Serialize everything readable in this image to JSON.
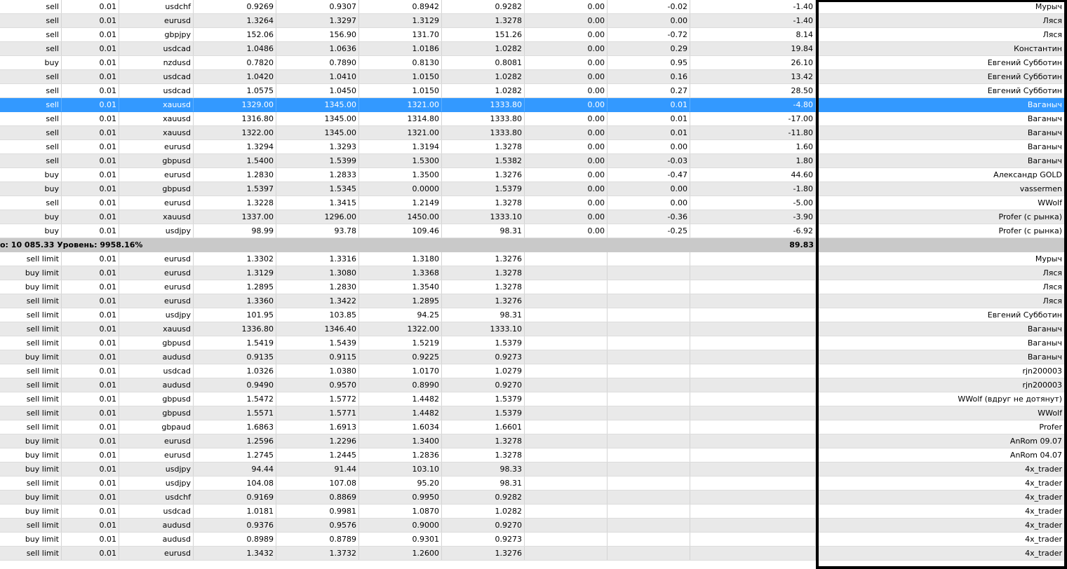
{
  "positions": [
    {
      "type": "sell",
      "volume": "0.01",
      "symbol": "usdchf",
      "price": "0.9269",
      "sl": "0.9307",
      "tp": "0.8942",
      "current": "0.9282",
      "commission": "0.00",
      "swap": "-0.02",
      "profit": "-1.40",
      "comment": "Мурыч"
    },
    {
      "type": "sell",
      "volume": "0.01",
      "symbol": "eurusd",
      "price": "1.3264",
      "sl": "1.3297",
      "tp": "1.3129",
      "current": "1.3278",
      "commission": "0.00",
      "swap": "0.00",
      "profit": "-1.40",
      "comment": "Ляся"
    },
    {
      "type": "sell",
      "volume": "0.01",
      "symbol": "gbpjpy",
      "price": "152.06",
      "sl": "156.90",
      "tp": "131.70",
      "current": "151.26",
      "commission": "0.00",
      "swap": "-0.72",
      "profit": "8.14",
      "comment": "Ляся"
    },
    {
      "type": "sell",
      "volume": "0.01",
      "symbol": "usdcad",
      "price": "1.0486",
      "sl": "1.0636",
      "tp": "1.0186",
      "current": "1.0282",
      "commission": "0.00",
      "swap": "0.29",
      "profit": "19.84",
      "comment": "Константин"
    },
    {
      "type": "buy",
      "volume": "0.01",
      "symbol": "nzdusd",
      "price": "0.7820",
      "sl": "0.7890",
      "tp": "0.8130",
      "current": "0.8081",
      "commission": "0.00",
      "swap": "0.95",
      "profit": "26.10",
      "comment": "Евгений Субботин"
    },
    {
      "type": "sell",
      "volume": "0.01",
      "symbol": "usdcad",
      "price": "1.0420",
      "sl": "1.0410",
      "tp": "1.0150",
      "current": "1.0282",
      "commission": "0.00",
      "swap": "0.16",
      "profit": "13.42",
      "comment": "Евгений Субботин"
    },
    {
      "type": "sell",
      "volume": "0.01",
      "symbol": "usdcad",
      "price": "1.0575",
      "sl": "1.0450",
      "tp": "1.0150",
      "current": "1.0282",
      "commission": "0.00",
      "swap": "0.27",
      "profit": "28.50",
      "comment": "Евгений Субботин"
    },
    {
      "type": "sell",
      "volume": "0.01",
      "symbol": "xauusd",
      "price": "1329.00",
      "sl": "1345.00",
      "tp": "1321.00",
      "current": "1333.80",
      "commission": "0.00",
      "swap": "0.01",
      "profit": "-4.80",
      "comment": "Ваганыч",
      "selected": true
    },
    {
      "type": "sell",
      "volume": "0.01",
      "symbol": "xauusd",
      "price": "1316.80",
      "sl": "1345.00",
      "tp": "1314.80",
      "current": "1333.80",
      "commission": "0.00",
      "swap": "0.01",
      "profit": "-17.00",
      "comment": "Ваганыч"
    },
    {
      "type": "sell",
      "volume": "0.01",
      "symbol": "xauusd",
      "price": "1322.00",
      "sl": "1345.00",
      "tp": "1321.00",
      "current": "1333.80",
      "commission": "0.00",
      "swap": "0.01",
      "profit": "-11.80",
      "comment": "Ваганыч"
    },
    {
      "type": "sell",
      "volume": "0.01",
      "symbol": "eurusd",
      "price": "1.3294",
      "sl": "1.3293",
      "tp": "1.3194",
      "current": "1.3278",
      "commission": "0.00",
      "swap": "0.00",
      "profit": "1.60",
      "comment": "Ваганыч"
    },
    {
      "type": "sell",
      "volume": "0.01",
      "symbol": "gbpusd",
      "price": "1.5400",
      "sl": "1.5399",
      "tp": "1.5300",
      "current": "1.5382",
      "commission": "0.00",
      "swap": "-0.03",
      "profit": "1.80",
      "comment": "Ваганыч"
    },
    {
      "type": "buy",
      "volume": "0.01",
      "symbol": "eurusd",
      "price": "1.2830",
      "sl": "1.2833",
      "tp": "1.3500",
      "current": "1.3276",
      "commission": "0.00",
      "swap": "-0.47",
      "profit": "44.60",
      "comment": "Александр GOLD"
    },
    {
      "type": "buy",
      "volume": "0.01",
      "symbol": "gbpusd",
      "price": "1.5397",
      "sl": "1.5345",
      "tp": "0.0000",
      "current": "1.5379",
      "commission": "0.00",
      "swap": "0.00",
      "profit": "-1.80",
      "comment": "vassermen"
    },
    {
      "type": "sell",
      "volume": "0.01",
      "symbol": "eurusd",
      "price": "1.3228",
      "sl": "1.3415",
      "tp": "1.2149",
      "current": "1.3278",
      "commission": "0.00",
      "swap": "0.00",
      "profit": "-5.00",
      "comment": "WWolf"
    },
    {
      "type": "buy",
      "volume": "0.01",
      "symbol": "xauusd",
      "price": "1337.00",
      "sl": "1296.00",
      "tp": "1450.00",
      "current": "1333.10",
      "commission": "0.00",
      "swap": "-0.36",
      "profit": "-3.90",
      "comment": "Profer (с рынка)"
    },
    {
      "type": "buy",
      "volume": "0.01",
      "symbol": "usdjpy",
      "price": "98.99",
      "sl": "93.78",
      "tp": "109.46",
      "current": "98.31",
      "commission": "0.00",
      "swap": "-0.25",
      "profit": "-6.92",
      "comment": "Profer (с рынка)"
    }
  ],
  "summary": {
    "text": "o: 10 085.33  Уровень: 9958.16%",
    "profit": "89.83"
  },
  "orders": [
    {
      "type": "sell limit",
      "volume": "0.01",
      "symbol": "eurusd",
      "price": "1.3302",
      "sl": "1.3316",
      "tp": "1.3180",
      "current": "1.3276",
      "comment": "Мурыч"
    },
    {
      "type": "buy limit",
      "volume": "0.01",
      "symbol": "eurusd",
      "price": "1.3129",
      "sl": "1.3080",
      "tp": "1.3368",
      "current": "1.3278",
      "comment": "Ляся"
    },
    {
      "type": "buy limit",
      "volume": "0.01",
      "symbol": "eurusd",
      "price": "1.2895",
      "sl": "1.2830",
      "tp": "1.3540",
      "current": "1.3278",
      "comment": "Ляся"
    },
    {
      "type": "sell limit",
      "volume": "0.01",
      "symbol": "eurusd",
      "price": "1.3360",
      "sl": "1.3422",
      "tp": "1.2895",
      "current": "1.3276",
      "comment": "Ляся"
    },
    {
      "type": "sell limit",
      "volume": "0.01",
      "symbol": "usdjpy",
      "price": "101.95",
      "sl": "103.85",
      "tp": "94.25",
      "current": "98.31",
      "comment": "Евгений Субботин"
    },
    {
      "type": "sell limit",
      "volume": "0.01",
      "symbol": "xauusd",
      "price": "1336.80",
      "sl": "1346.40",
      "tp": "1322.00",
      "current": "1333.10",
      "comment": "Ваганыч"
    },
    {
      "type": "sell limit",
      "volume": "0.01",
      "symbol": "gbpusd",
      "price": "1.5419",
      "sl": "1.5439",
      "tp": "1.5219",
      "current": "1.5379",
      "comment": "Ваганыч"
    },
    {
      "type": "buy limit",
      "volume": "0.01",
      "symbol": "audusd",
      "price": "0.9135",
      "sl": "0.9115",
      "tp": "0.9225",
      "current": "0.9273",
      "comment": "Ваганыч"
    },
    {
      "type": "sell limit",
      "volume": "0.01",
      "symbol": "usdcad",
      "price": "1.0326",
      "sl": "1.0380",
      "tp": "1.0170",
      "current": "1.0279",
      "comment": "rjn200003"
    },
    {
      "type": "sell limit",
      "volume": "0.01",
      "symbol": "audusd",
      "price": "0.9490",
      "sl": "0.9570",
      "tp": "0.8990",
      "current": "0.9270",
      "comment": "rjn200003"
    },
    {
      "type": "sell limit",
      "volume": "0.01",
      "symbol": "gbpusd",
      "price": "1.5472",
      "sl": "1.5772",
      "tp": "1.4482",
      "current": "1.5379",
      "comment": "WWolf (вдруг не дотянут)"
    },
    {
      "type": "sell limit",
      "volume": "0.01",
      "symbol": "gbpusd",
      "price": "1.5571",
      "sl": "1.5771",
      "tp": "1.4482",
      "current": "1.5379",
      "comment": "WWolf"
    },
    {
      "type": "sell limit",
      "volume": "0.01",
      "symbol": "gbpaud",
      "price": "1.6863",
      "sl": "1.6913",
      "tp": "1.6034",
      "current": "1.6601",
      "comment": "Profer"
    },
    {
      "type": "buy limit",
      "volume": "0.01",
      "symbol": "eurusd",
      "price": "1.2596",
      "sl": "1.2296",
      "tp": "1.3400",
      "current": "1.3278",
      "comment": "AnRom 09.07"
    },
    {
      "type": "buy limit",
      "volume": "0.01",
      "symbol": "eurusd",
      "price": "1.2745",
      "sl": "1.2445",
      "tp": "1.2836",
      "current": "1.3278",
      "comment": "AnRom 04.07"
    },
    {
      "type": "buy limit",
      "volume": "0.01",
      "symbol": "usdjpy",
      "price": "94.44",
      "sl": "91.44",
      "tp": "103.10",
      "current": "98.33",
      "comment": "4x_trader"
    },
    {
      "type": "sell limit",
      "volume": "0.01",
      "symbol": "usdjpy",
      "price": "104.08",
      "sl": "107.08",
      "tp": "95.20",
      "current": "98.31",
      "comment": "4x_trader"
    },
    {
      "type": "buy limit",
      "volume": "0.01",
      "symbol": "usdchf",
      "price": "0.9169",
      "sl": "0.8869",
      "tp": "0.9950",
      "current": "0.9282",
      "comment": "4x_trader"
    },
    {
      "type": "buy limit",
      "volume": "0.01",
      "symbol": "usdcad",
      "price": "1.0181",
      "sl": "0.9981",
      "tp": "1.0870",
      "current": "1.0282",
      "comment": "4x_trader"
    },
    {
      "type": "sell limit",
      "volume": "0.01",
      "symbol": "audusd",
      "price": "0.9376",
      "sl": "0.9576",
      "tp": "0.9000",
      "current": "0.9270",
      "comment": "4x_trader"
    },
    {
      "type": "buy limit",
      "volume": "0.01",
      "symbol": "audusd",
      "price": "0.8989",
      "sl": "0.8789",
      "tp": "0.9301",
      "current": "0.9273",
      "comment": "4x_trader"
    },
    {
      "type": "sell limit",
      "volume": "0.01",
      "symbol": "eurusd",
      "price": "1.3432",
      "sl": "1.3732",
      "tp": "1.2600",
      "current": "1.3276",
      "comment": "4x_trader"
    }
  ],
  "colors": {
    "selected_row": "#3399ff",
    "alt_row": "#e9e9e9",
    "summary_row": "#c9c9c9",
    "highlight_frame": "#000000"
  }
}
